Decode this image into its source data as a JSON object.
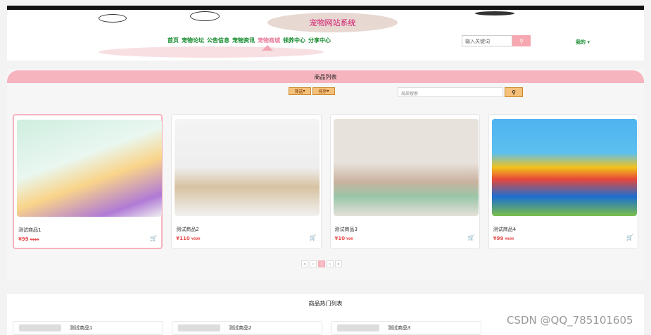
{
  "header": {
    "title": "宠物网站系统",
    "nav": [
      "首页",
      "宠物论坛",
      "公告信息",
      "宠物资讯",
      "宠物商城",
      "领养中心",
      "分享中心"
    ],
    "active_nav": "宠物商城",
    "search_placeholder": "输入关键词",
    "mine": "我的"
  },
  "list": {
    "title": "商品列表",
    "filter": "筛选",
    "sort": "排序",
    "local_search_placeholder": "局部搜索"
  },
  "products": [
    {
      "name": "测试商品1",
      "price": "¥99",
      "old_price": "¥110"
    },
    {
      "name": "测试商品2",
      "price": "¥110",
      "old_price": "¥220"
    },
    {
      "name": "测试商品3",
      "price": "¥10",
      "old_price": "¥20"
    },
    {
      "name": "测试商品4",
      "price": "¥99",
      "old_price": "¥100"
    }
  ],
  "pagination": {
    "current": 1
  },
  "hot": {
    "title": "商品热门列表",
    "items": [
      "测试商品1",
      "测试商品2",
      "测试商品3"
    ]
  },
  "watermark": "CSDN @QQ_785101605",
  "colors": {
    "accent_pink": "#f6b4be",
    "nav_green": "#118a2a",
    "title_magenta": "#d0196e",
    "price_red": "#e84a4a"
  }
}
